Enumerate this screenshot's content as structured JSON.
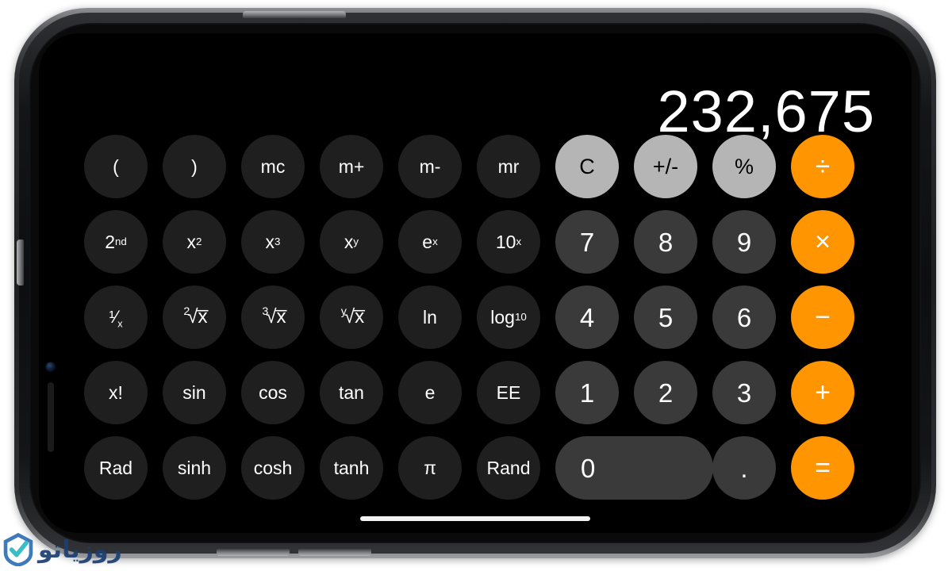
{
  "device": {
    "name": "iphone-landscape",
    "hardware_buttons": [
      "power",
      "volume-up",
      "volume-down",
      "ring-silent-switch"
    ],
    "notch_elements": [
      "front-camera",
      "earpiece-speaker"
    ],
    "home_indicator": true
  },
  "app": {
    "name": "Calculator",
    "mode": "scientific-landscape",
    "display_value": "232,675"
  },
  "colors": {
    "screen_background": "#000000",
    "function_key": "#1f1f1f",
    "number_key": "#3a3a3a",
    "top_key": "#b5b5b5",
    "operator_key": "#ff9500",
    "display_text": "#ffffff",
    "frame_dark": "#1d1f21",
    "frame_light": "#9b9da0",
    "watermark_blue": "#1b3f72",
    "watermark_teal": "#2bb8c4"
  },
  "keypad": {
    "rows": [
      [
        {
          "label": "(",
          "name": "key-open-paren",
          "style": "fn"
        },
        {
          "label": ")",
          "name": "key-close-paren",
          "style": "fn"
        },
        {
          "label": "mc",
          "name": "key-memory-clear",
          "style": "fn"
        },
        {
          "label": "m+",
          "name": "key-memory-add",
          "style": "fn"
        },
        {
          "label": "m-",
          "name": "key-memory-subtract",
          "style": "fn"
        },
        {
          "label": "mr",
          "name": "key-memory-recall",
          "style": "fn"
        },
        {
          "label": "C",
          "name": "key-clear",
          "style": "top"
        },
        {
          "label": "+/-",
          "name": "key-sign-toggle",
          "style": "top"
        },
        {
          "label": "%",
          "name": "key-percent",
          "style": "top"
        },
        {
          "label": "÷",
          "name": "key-divide",
          "style": "op"
        }
      ],
      [
        {
          "label": "2nd",
          "name": "key-second-function",
          "style": "fn",
          "html": "2<sup>nd</sup>"
        },
        {
          "label": "x2",
          "name": "key-x-squared",
          "style": "fn",
          "html": "x<sup>2</sup>"
        },
        {
          "label": "x3",
          "name": "key-x-cubed",
          "style": "fn",
          "html": "x<sup>3</sup>"
        },
        {
          "label": "xy",
          "name": "key-x-power-y",
          "style": "fn",
          "html": "x<sup>y</sup>"
        },
        {
          "label": "ex",
          "name": "key-e-power-x",
          "style": "fn",
          "html": "e<sup>x</sup>"
        },
        {
          "label": "10x",
          "name": "key-ten-power-x",
          "style": "fn",
          "html": "10<sup>x</sup>"
        },
        {
          "label": "7",
          "name": "key-7",
          "style": "num"
        },
        {
          "label": "8",
          "name": "key-8",
          "style": "num"
        },
        {
          "label": "9",
          "name": "key-9",
          "style": "num"
        },
        {
          "label": "×",
          "name": "key-multiply",
          "style": "op"
        }
      ],
      [
        {
          "label": "1/x",
          "name": "key-reciprocal",
          "style": "fn",
          "html": "<span class=\"frac\">¹⁄<sub>x</sub></span>"
        },
        {
          "label": "2√x",
          "name": "key-square-root",
          "style": "fn",
          "html": "<span class=\"radix\">2</span><span class=\"rootsym\">√x̅</span>"
        },
        {
          "label": "3√x",
          "name": "key-cube-root",
          "style": "fn",
          "html": "<span class=\"radix\">3</span><span class=\"rootsym\">√x̅</span>"
        },
        {
          "label": "y√x",
          "name": "key-y-root-x",
          "style": "fn",
          "html": "<span class=\"radix\">y</span><span class=\"rootsym\">√x̅</span>"
        },
        {
          "label": "ln",
          "name": "key-natural-log",
          "style": "fn"
        },
        {
          "label": "log10",
          "name": "key-log-base-10",
          "style": "fn",
          "html": "log<sub>10</sub>"
        },
        {
          "label": "4",
          "name": "key-4",
          "style": "num"
        },
        {
          "label": "5",
          "name": "key-5",
          "style": "num"
        },
        {
          "label": "6",
          "name": "key-6",
          "style": "num"
        },
        {
          "label": "−",
          "name": "key-subtract",
          "style": "op"
        }
      ],
      [
        {
          "label": "x!",
          "name": "key-factorial",
          "style": "fn"
        },
        {
          "label": "sin",
          "name": "key-sine",
          "style": "fn"
        },
        {
          "label": "cos",
          "name": "key-cosine",
          "style": "fn"
        },
        {
          "label": "tan",
          "name": "key-tangent",
          "style": "fn"
        },
        {
          "label": "e",
          "name": "key-euler-number",
          "style": "fn"
        },
        {
          "label": "EE",
          "name": "key-exponent-entry",
          "style": "fn"
        },
        {
          "label": "1",
          "name": "key-1",
          "style": "num"
        },
        {
          "label": "2",
          "name": "key-2",
          "style": "num"
        },
        {
          "label": "3",
          "name": "key-3",
          "style": "num"
        },
        {
          "label": "+",
          "name": "key-add",
          "style": "op"
        }
      ],
      [
        {
          "label": "Rad",
          "name": "key-radian-mode",
          "style": "fn"
        },
        {
          "label": "sinh",
          "name": "key-hyperbolic-sine",
          "style": "fn"
        },
        {
          "label": "cosh",
          "name": "key-hyperbolic-cosine",
          "style": "fn"
        },
        {
          "label": "tanh",
          "name": "key-hyperbolic-tangent",
          "style": "fn"
        },
        {
          "label": "π",
          "name": "key-pi",
          "style": "fn"
        },
        {
          "label": "Rand",
          "name": "key-random",
          "style": "fn"
        },
        {
          "label": "0",
          "name": "key-0",
          "style": "num zero"
        },
        {
          "label": ".",
          "name": "key-decimal-point",
          "style": "num"
        },
        {
          "label": "=",
          "name": "key-equals",
          "style": "op"
        }
      ]
    ]
  },
  "watermark": {
    "text": "روزیاتو",
    "icon": "check-badge-icon"
  }
}
